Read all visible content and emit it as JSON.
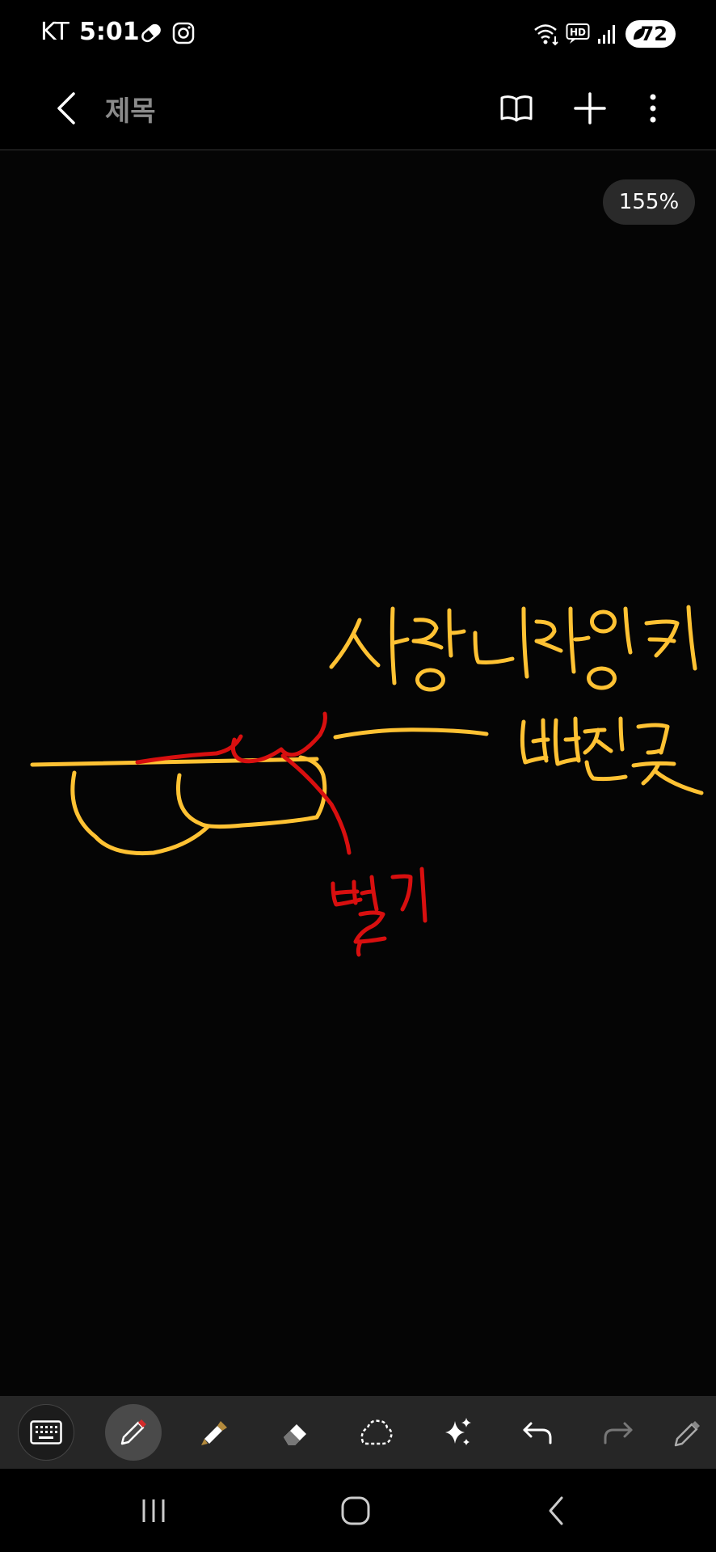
{
  "status_bar": {
    "carrier": "KT",
    "time": "5:01",
    "battery_level": "72",
    "icons": [
      "pill-icon",
      "instagram-icon",
      "wifi-icon",
      "hd-voice-icon",
      "signal-icon",
      "battery-icon"
    ]
  },
  "app_bar": {
    "title": "제목",
    "icons": [
      "back-icon",
      "book-icon",
      "plus-icon",
      "more-vertical-icon"
    ]
  },
  "canvas": {
    "zoom": "155%",
    "colors": {
      "yellow_ink": "#ffc233",
      "red_ink": "#d80f0f"
    }
  },
  "toolbar": {
    "tools": [
      "keyboard-icon",
      "pen-icon",
      "highlighter-icon",
      "eraser-icon",
      "lasso-icon",
      "sparkle-icon",
      "undo-icon",
      "redo-icon",
      "more-pen-icon"
    ],
    "active_tool": "pen-icon",
    "pen_color": "#d42b2b",
    "highlighter_color": "#b38a3c"
  },
  "nav_bar": {
    "icons": [
      "recents-icon",
      "home-icon",
      "back-nav-icon"
    ]
  }
}
